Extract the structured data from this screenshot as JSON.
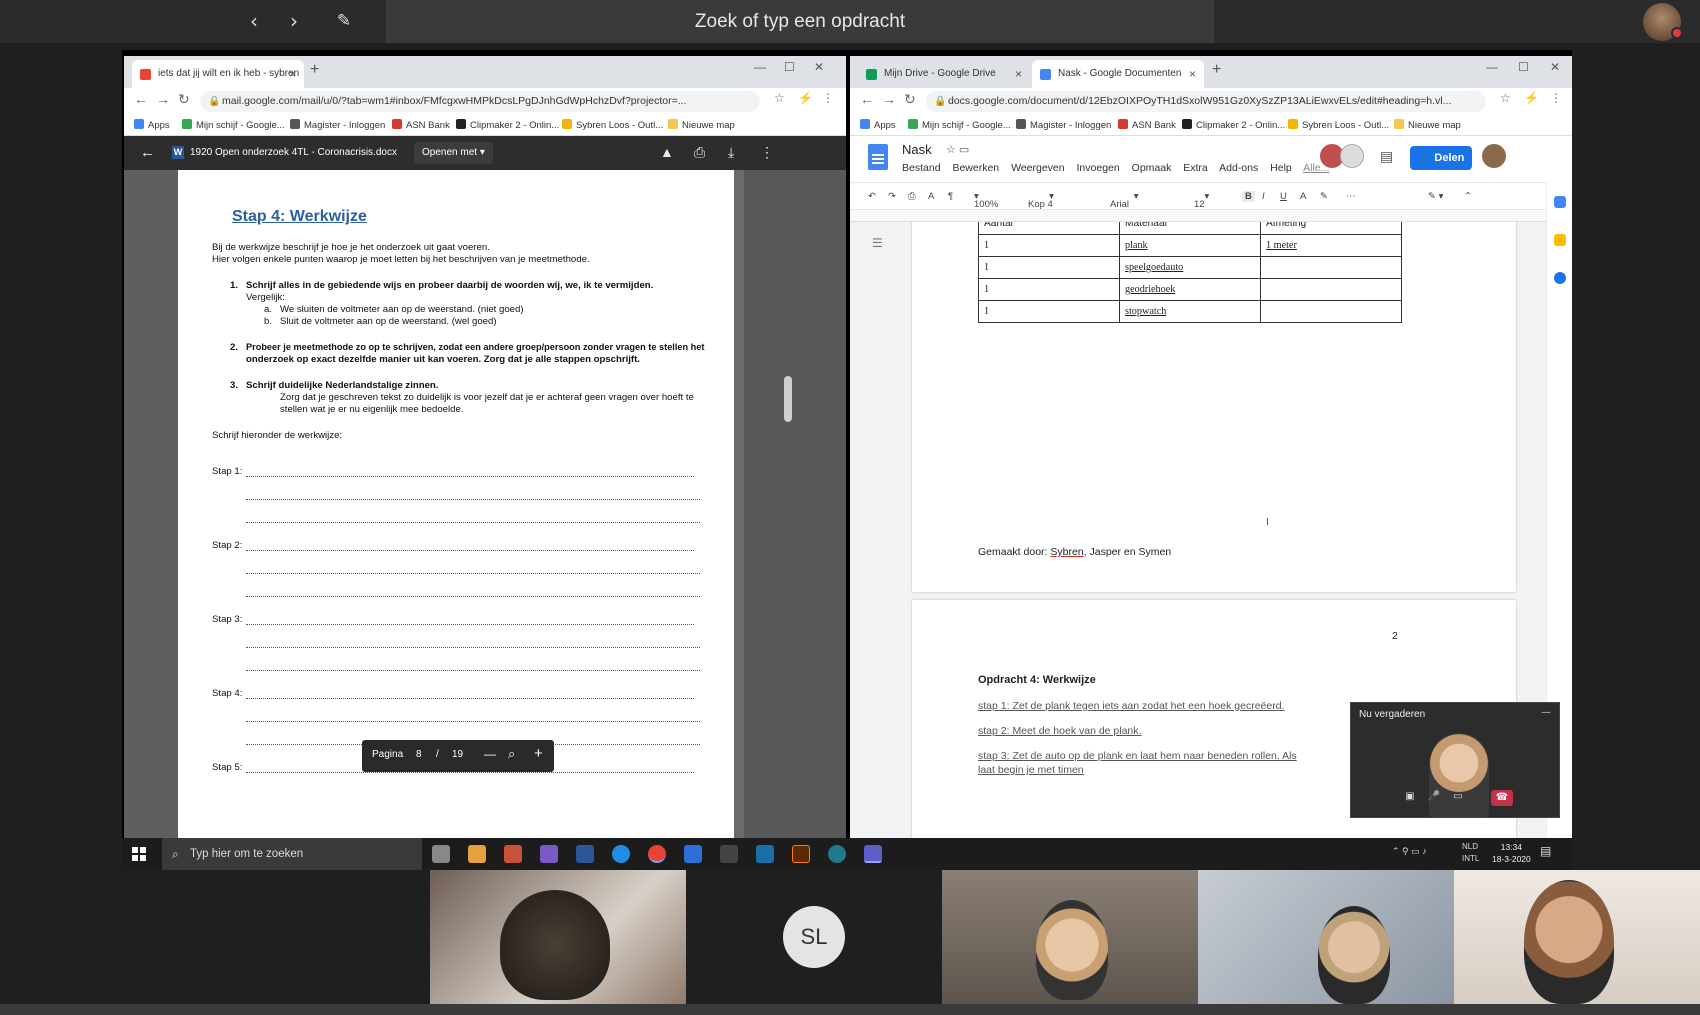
{
  "teams": {
    "search_placeholder": "Zoek of typ een opdracht"
  },
  "gmail_window": {
    "tab_title": "iets dat jij wilt en ik heb - sybren",
    "url": "mail.google.com/mail/u/0/?tab=wm1#inbox/FMfcgxwHMPkDcsLPgDJnhGdWpHchzDvf?projector=...",
    "bookmarks": [
      "Apps",
      "Mijn schijf - Google...",
      "Magister - Inloggen",
      "ASN Bank",
      "Clipmaker 2 - Onlin...",
      "Sybren Loos - Outl...",
      "Nieuwe map"
    ],
    "viewer": {
      "file_name": "1920 Open onderzoek 4TL - Coronacrisis.docx",
      "open_with": "Openen met",
      "page_label": "Pagina",
      "page_current": "8",
      "page_sep": "/",
      "page_total": "19"
    },
    "document": {
      "heading": "Stap 4: Werkwijze",
      "intro1": "Bij de werkwijze beschrijf je hoe je het onderzoek uit gaat voeren.",
      "intro2": "Hier volgen enkele punten waarop je moet letten bij het beschrijven van je meetmethode.",
      "p1_num": "1.",
      "p1": "Schrijf alles in de gebiedende wijs en probeer daarbij de woorden wij, we, ik te vermijden.",
      "p1_sub": "Vergelijk:",
      "p1_a_num": "a.",
      "p1_a": "We sluiten de voltmeter aan op de weerstand. (niet goed)",
      "p1_b_num": "b.",
      "p1_b": "Sluit de voltmeter aan op de weerstand. (wel goed)",
      "p2_num": "2.",
      "p2_l1": "Probeer je meetmethode zo op te schrijven, zodat een andere groep/persoon zonder vragen te stellen het",
      "p2_l2": "onderzoek op exact dezelfde manier uit kan voeren. Zorg dat je alle stappen opschrijft.",
      "p3_num": "3.",
      "p3": "Schrijf duidelijke Nederlandstalige zinnen.",
      "p3_l1": "Zorg dat je geschreven tekst zo duidelijk is voor jezelf dat je er achteraf geen vragen over hoeft te",
      "p3_l2": "stellen wat je er nu eigenlijk mee bedoelde.",
      "write_below": "Schrijf hieronder de werkwijze:",
      "steps": [
        "Stap 1:",
        "Stap 2:",
        "Stap 3:",
        "Stap 4:",
        "Stap 5:"
      ]
    }
  },
  "docs_window": {
    "tabs": [
      "Mijn Drive - Google Drive",
      "Nask - Google Documenten"
    ],
    "url": "docs.google.com/document/d/12EbzOIXPOyTH1dSxolW951Gz0XySzZP13ALiEwxvELs/edit#heading=h.vl...",
    "bookmarks": [
      "Apps",
      "Mijn schijf - Google...",
      "Magister - Inloggen",
      "ASN Bank",
      "Clipmaker 2 - Onlin...",
      "Sybren Loos - Outl...",
      "Nieuwe map"
    ],
    "doc_title": "Nask",
    "menu": [
      "Bestand",
      "Bewerken",
      "Weergeven",
      "Invoegen",
      "Opmaak",
      "Extra",
      "Add-ons",
      "Help",
      "Alle..."
    ],
    "share_label": "Delen",
    "toolbar": {
      "zoom": "100%",
      "style": "Kop 4",
      "font": "Arial",
      "size": "12"
    },
    "table": {
      "headers": [
        "Aantal",
        "Materiaal",
        "Afmeting"
      ],
      "rows": [
        [
          "1",
          "plank",
          "1 meter"
        ],
        [
          "1",
          "speelgoedauto",
          ""
        ],
        [
          "1",
          "geodriehoek",
          ""
        ],
        [
          "1",
          "stopwatch",
          ""
        ]
      ]
    },
    "made_by_prefix": "Gemaakt door:",
    "made_by_name": "Sybren",
    "made_by_rest": ", Jasper en Symen",
    "page_number": "2",
    "assignment_title": "Opdracht 4: Werkwijze",
    "steps": [
      "stap 1: Zet de plank tegen iets aan zodat het een hoek gecreëerd.",
      "stap 2: Meet de hoek van de plank.",
      "stap 3: Zet de auto op de plank en laat hem naar beneden rollen. Als",
      "laat begin je met timen"
    ]
  },
  "mini_meeting": {
    "label": "Nu vergaderen"
  },
  "taskbar": {
    "search_placeholder": "Typ hier om te zoeken",
    "lang_top": "NLD",
    "lang_bottom": "INTL",
    "time": "13:34",
    "date": "18-3-2020"
  },
  "participants": {
    "initials": "SL"
  }
}
